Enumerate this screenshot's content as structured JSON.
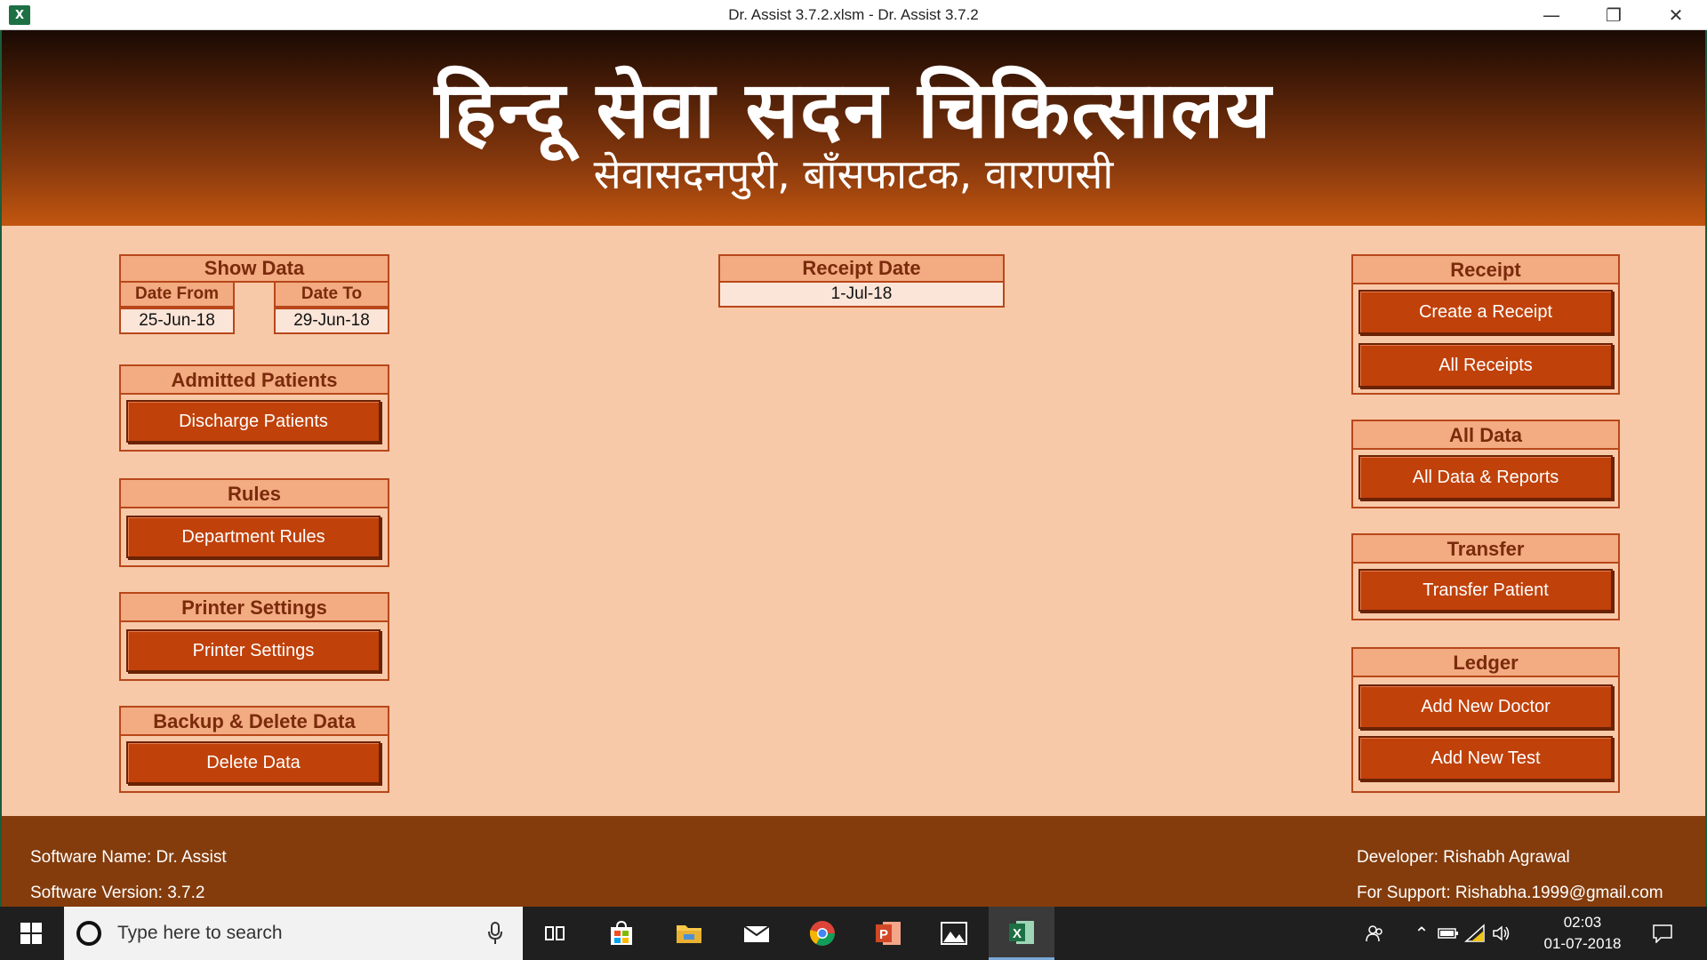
{
  "window": {
    "title": "Dr. Assist 3.7.2.xlsm - Dr. Assist 3.7.2",
    "app_icon": "excel-icon",
    "controls": [
      "minimize-icon",
      "restore-icon",
      "close-icon"
    ]
  },
  "header": {
    "title": "हिन्दू सेवा सदन चिकित्सालय",
    "subtitle": "सेवासदनपुरी, बाँसफाटक, वाराणसी"
  },
  "show_data": {
    "heading": "Show Data",
    "date_from_label": "Date From",
    "date_from_value": "25-Jun-18",
    "date_to_label": "Date To",
    "date_to_value": "29-Jun-18"
  },
  "receipt_date": {
    "heading": "Receipt Date",
    "value": "1-Jul-18"
  },
  "left_panels": {
    "admitted": {
      "heading": "Admitted Patients",
      "button": "Discharge Patients"
    },
    "rules": {
      "heading": "Rules",
      "button": "Department Rules"
    },
    "printer": {
      "heading": "Printer Settings",
      "button": "Printer Settings"
    },
    "backup": {
      "heading": "Backup & Delete Data",
      "button": "Delete Data"
    }
  },
  "right_panels": {
    "receipt": {
      "heading": "Receipt",
      "buttons": [
        "Create a Receipt",
        "All Receipts"
      ]
    },
    "all_data": {
      "heading": "All Data",
      "button": "All Data & Reports"
    },
    "transfer": {
      "heading": "Transfer",
      "button": "Transfer Patient"
    },
    "ledger": {
      "heading": "Ledger",
      "buttons": [
        "Add New Doctor",
        "Add New Test"
      ]
    }
  },
  "footer": {
    "software_name": "Software Name: Dr. Assist",
    "software_version": "Software Version: 3.7.2",
    "developer": "Developer: Rishabh Agrawal",
    "support": "For Support: Rishabha.1999@gmail.com"
  },
  "taskbar": {
    "search_placeholder": "Type here to search",
    "apps": [
      "task-view-icon",
      "store-icon",
      "file-explorer-icon",
      "mail-icon",
      "chrome-icon",
      "powerpoint-icon",
      "photos-icon",
      "excel-icon"
    ],
    "time": "02:03",
    "date": "01-07-2018"
  },
  "colors": {
    "background": "#f7c9a8",
    "header_dark": "#1a0a03",
    "header_light": "#c2560f",
    "panel_head": "#f3ab82",
    "button": "#c0410a",
    "footer": "#843c0c"
  }
}
